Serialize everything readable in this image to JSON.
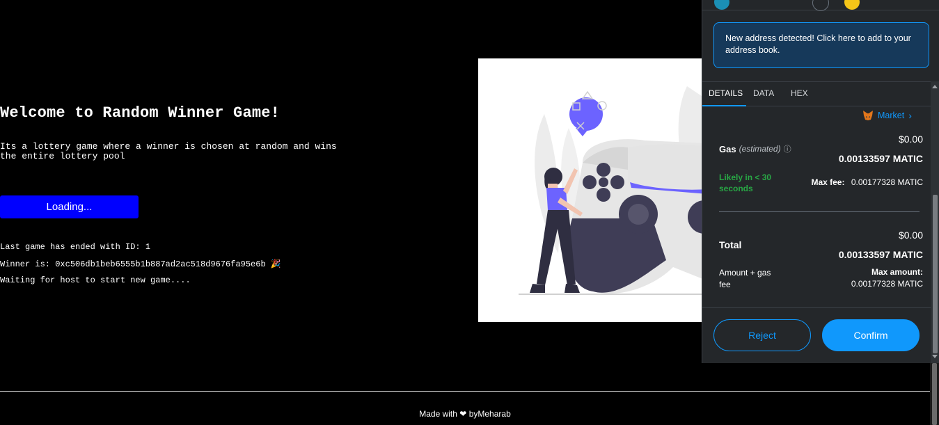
{
  "game": {
    "title": "Welcome to Random Winner Game!",
    "description": "Its a lottery game where a winner is chosen at random and wins the entire lottery pool",
    "button_label": "Loading...",
    "status_lines": [
      "Last game has ended with ID: 1",
      "Winner is: 0xc506db1beb6555b1b887ad2ac518d9676fa95e6b 🎉",
      "Waiting for host to start new game...."
    ],
    "footer_prefix": "Made with",
    "footer_suffix": "byMeharab"
  },
  "metamask": {
    "notice": "New address detected! Click here to add to your address book.",
    "tabs": [
      "DETAILS",
      "DATA",
      "HEX"
    ],
    "active_tab": "DETAILS",
    "market_label": "Market",
    "gas": {
      "label": "Gas",
      "estimated": "(estimated)",
      "usd": "$0.00",
      "amount": "0.00133597 MATIC",
      "likely": "Likely in < 30 seconds",
      "max_fee_label": "Max fee:",
      "max_fee_value": "0.00177328 MATIC"
    },
    "total": {
      "label": "Total",
      "usd": "$0.00",
      "amount": "0.00133597 MATIC",
      "sub_label": "Amount + gas fee",
      "max_amount_label": "Max amount:",
      "max_amount_value": "0.00177328 MATIC"
    },
    "reject_label": "Reject",
    "confirm_label": "Confirm",
    "colors": {
      "accent": "#1098fc",
      "panel": "#24272a",
      "success": "#28a745"
    }
  }
}
